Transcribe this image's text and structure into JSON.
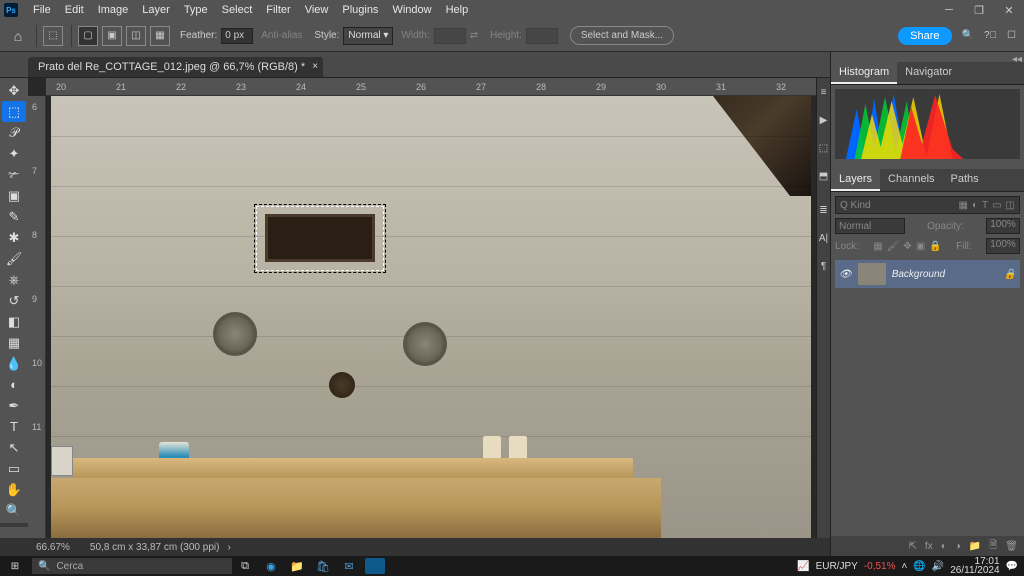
{
  "app": {
    "name": "Ps"
  },
  "menu": {
    "items": [
      "File",
      "Edit",
      "Image",
      "Layer",
      "Type",
      "Select",
      "Filter",
      "View",
      "Plugins",
      "Window",
      "Help"
    ]
  },
  "options": {
    "feather_label": "Feather:",
    "feather_value": "0 px",
    "antialias_label": "Anti-alias",
    "style_label": "Style:",
    "style_value": "Normal",
    "width_label": "Width:",
    "height_label": "Height:",
    "select_mask": "Select and Mask...",
    "share": "Share"
  },
  "document": {
    "tab_title": "Prato del Re_COTTAGE_012.jpeg @ 66,7% (RGB/8) *"
  },
  "ruler_h": [
    "20",
    "21",
    "22",
    "23",
    "24",
    "25",
    "26",
    "27",
    "28",
    "29",
    "30",
    "31",
    "32"
  ],
  "ruler_v": [
    "6",
    "7",
    "8",
    "9",
    "10",
    "11"
  ],
  "status": {
    "zoom": "66.67%",
    "doc_info": "50,8 cm x 33,87 cm (300 ppi)"
  },
  "panels": {
    "hist_tab": "Histogram",
    "nav_tab": "Navigator",
    "layers_tab": "Layers",
    "channels_tab": "Channels",
    "paths_tab": "Paths",
    "search_kind": "Q Kind",
    "blend_mode": "Normal",
    "opacity_label": "Opacity:",
    "opacity_value": "100%",
    "lock_label": "Lock:",
    "fill_label": "Fill:",
    "fill_value": "100%",
    "layer_name": "Background"
  },
  "taskbar": {
    "search_placeholder": "Cerca",
    "stock_pair": "EUR/JPY",
    "stock_change": "-0,51%",
    "time": "17:01",
    "date": "26/11/2024"
  }
}
